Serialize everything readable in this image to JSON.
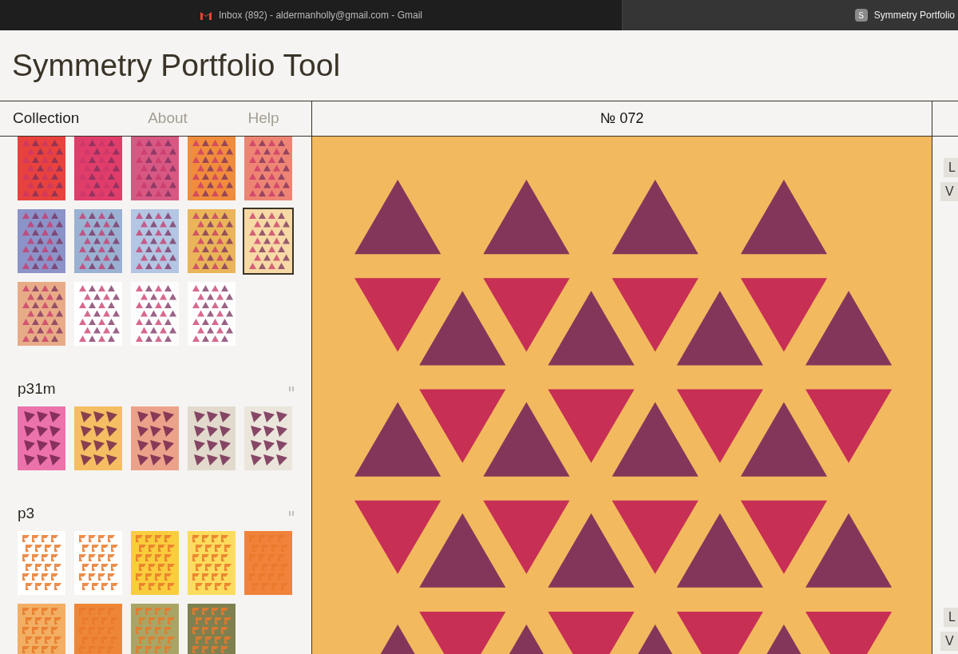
{
  "browser_tabs": [
    {
      "label": "Inbox (892) - aldermanholly@gmail.com - Gmail",
      "kind": "mail",
      "selected": false
    },
    {
      "label": "Symmetry Portfolio",
      "kind": "letter",
      "favicon": "S",
      "selected": true
    }
  ],
  "app": {
    "title": "Symmetry Portfolio Tool"
  },
  "nav": [
    {
      "label": "Collection",
      "selected": true
    },
    {
      "label": "About",
      "selected": false
    },
    {
      "label": "Help",
      "selected": false
    }
  ],
  "sections": [
    {
      "kind": "triangles",
      "thumbnails": [
        {
          "color": "#e8423e",
          "selected": false
        },
        {
          "color": "#e03d6a",
          "selected": false
        },
        {
          "color": "#d75883",
          "selected": false
        },
        {
          "color": "#f08c3c",
          "selected": false
        },
        {
          "color": "#ee8473",
          "selected": false
        },
        {
          "color": "#8c93c8",
          "selected": false
        },
        {
          "color": "#9ab1d2",
          "selected": false
        },
        {
          "color": "#b3c6e3",
          "selected": false
        },
        {
          "color": "#e9b558",
          "selected": false
        },
        {
          "color": "#f6d9a4",
          "selected": true
        },
        {
          "color": "#e8ab87",
          "selected": false
        },
        {
          "color": "#ffffff",
          "selected": false
        },
        {
          "color": "#fdfcfd",
          "selected": false
        },
        {
          "color": "#fefefe",
          "selected": false
        }
      ]
    },
    {
      "title": "p31m",
      "kind": "pinwheel",
      "thumbnails": [
        {
          "color": "#ec72ac",
          "selected": false
        },
        {
          "color": "#f5be63",
          "selected": false
        },
        {
          "color": "#eca28a",
          "selected": false
        },
        {
          "color": "#e2dacd",
          "selected": false
        },
        {
          "color": "#ebe6dc",
          "selected": false
        }
      ]
    },
    {
      "title": "p3",
      "kind": "swirl",
      "thumbnails": [
        {
          "color": "#ffffff",
          "selected": false
        },
        {
          "color": "#ffffff",
          "selected": false
        },
        {
          "color": "#f9cd3c",
          "selected": false
        },
        {
          "color": "#fbdc5c",
          "selected": false
        },
        {
          "color": "#f1823a",
          "selected": false
        },
        {
          "color": "#f2ae62",
          "selected": false
        },
        {
          "color": "#ee8638",
          "selected": false
        },
        {
          "color": "#a9a565",
          "selected": false
        },
        {
          "color": "#7f8050",
          "selected": false
        }
      ]
    }
  ],
  "main": {
    "heading": "№ 072"
  },
  "side_controls": [
    {
      "label": "L"
    },
    {
      "label": "V"
    },
    {
      "label": "L"
    },
    {
      "label": "V"
    }
  ]
}
